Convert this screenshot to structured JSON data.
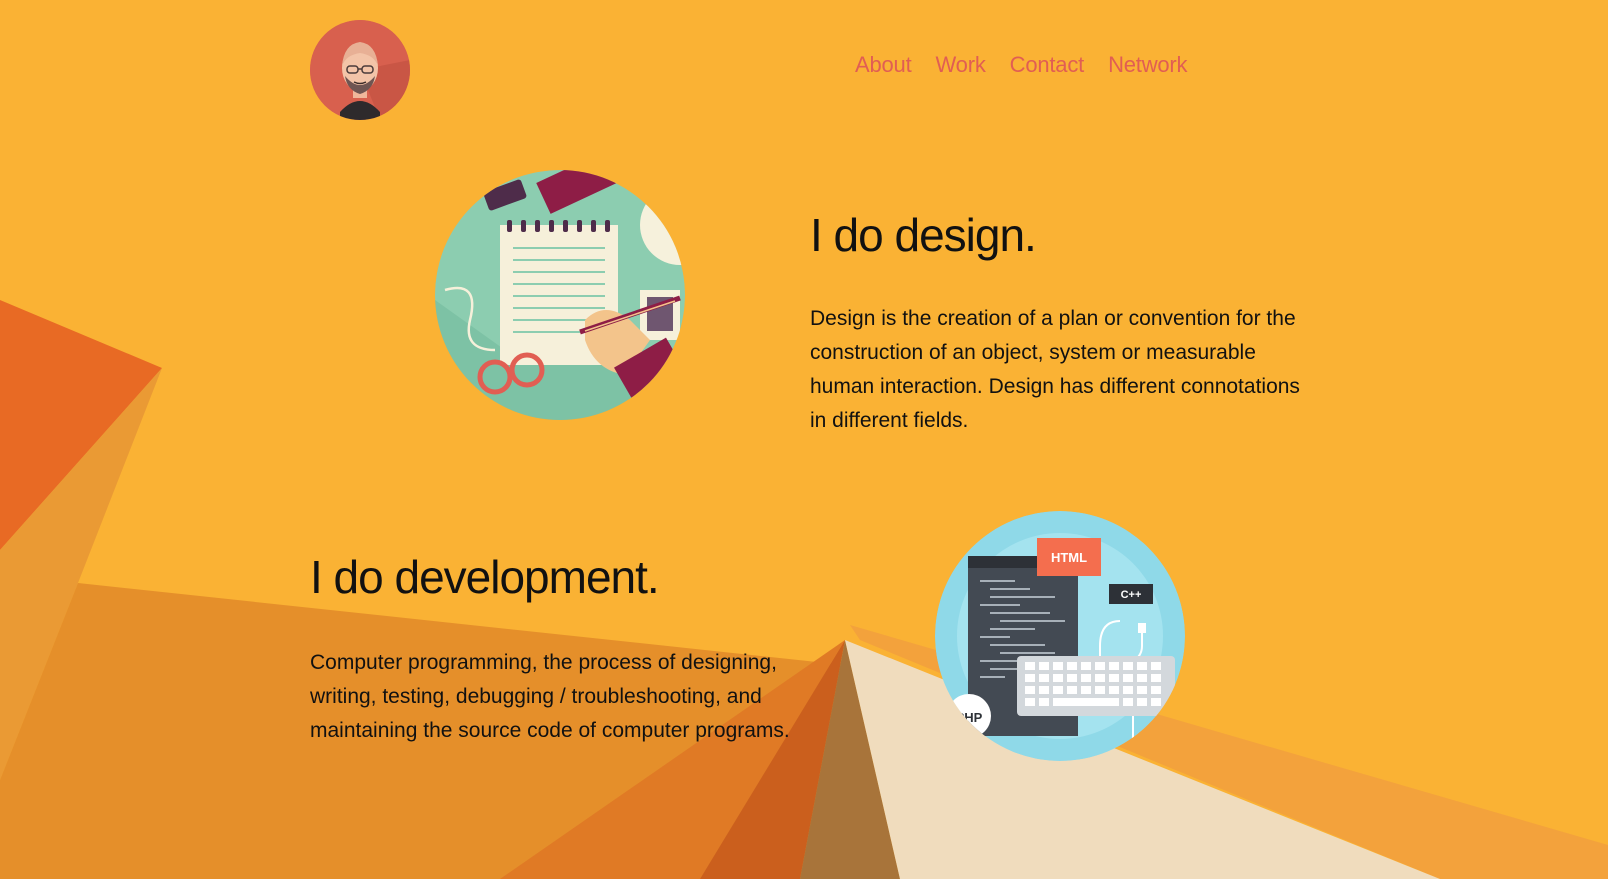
{
  "nav": {
    "items": [
      {
        "label": "About"
      },
      {
        "label": "Work"
      },
      {
        "label": "Contact"
      },
      {
        "label": "Network"
      }
    ]
  },
  "design": {
    "title": "I do design.",
    "text": "Design is the creation of a plan or convention for the construction of an object, system or measurable human interaction. Design has different connotations in different fields."
  },
  "development": {
    "title": "I do development.",
    "text": "Computer programming, the process of designing, writing, testing, debugging / troubleshooting, and maintaining the source code of computer programs."
  },
  "dev_illustration": {
    "badge_html": "HTML",
    "badge_cpp": "C++",
    "badge_php": "PHP"
  },
  "colors": {
    "background": "#FAB234",
    "nav_link": "#E15E53",
    "avatar_bg": "#D8604E",
    "text": "#111111"
  },
  "icons": {
    "avatar": "avatar-icon",
    "design_illustration": "design-illustration-icon",
    "dev_illustration": "development-illustration-icon"
  }
}
